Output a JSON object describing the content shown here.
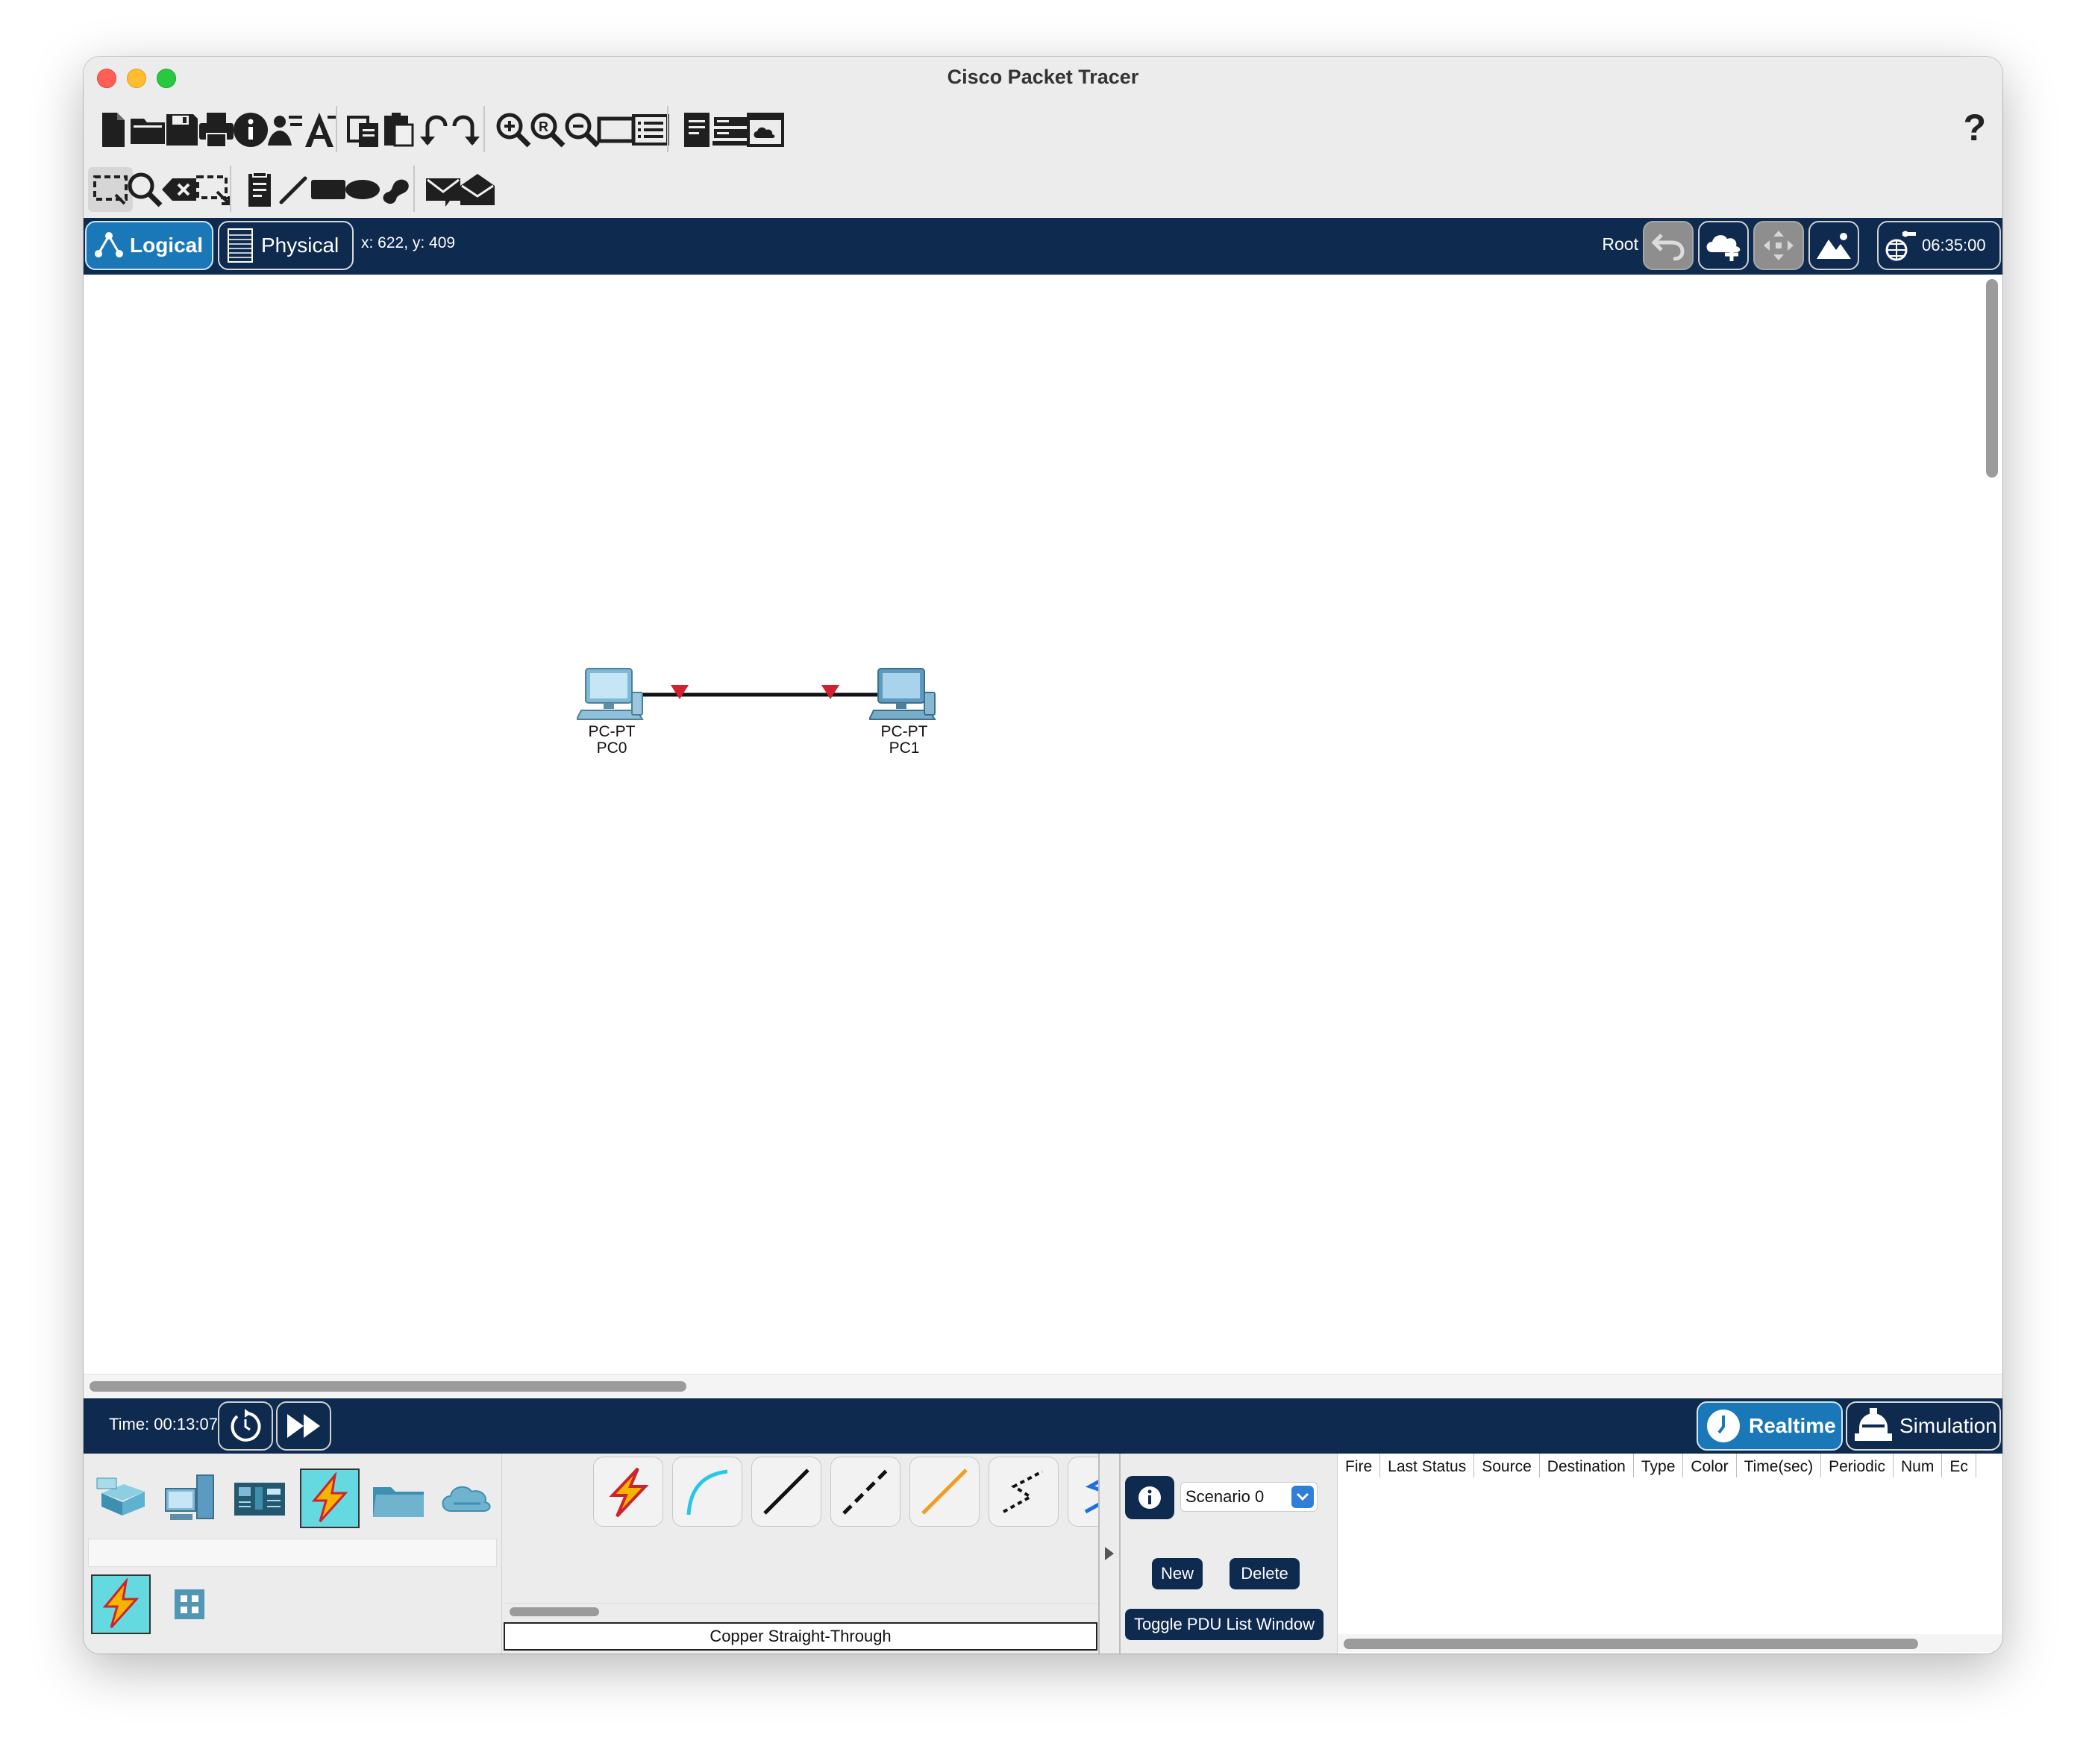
{
  "window": {
    "title": "Cisco Packet Tracer"
  },
  "toolbar": {
    "help_label": "?"
  },
  "nav": {
    "logical_label": "Logical",
    "physical_label": "Physical",
    "coords": "x: 622, y: 409",
    "root_label": "Root",
    "clock": "06:35:00"
  },
  "workspace": {
    "devices": [
      {
        "model": "PC-PT",
        "name": "PC0"
      },
      {
        "model": "PC-PT",
        "name": "PC1"
      }
    ]
  },
  "status": {
    "time": "Time: 00:13:07",
    "realtime_label": "Realtime",
    "simulation_label": "Simulation"
  },
  "cables": {
    "selected_name": "Copper Straight-Through"
  },
  "scenario": {
    "selected": "Scenario 0",
    "new_label": "New",
    "delete_label": "Delete",
    "toggle_label": "Toggle PDU List Window"
  },
  "pdu_list": {
    "columns": [
      "Fire",
      "Last Status",
      "Source",
      "Destination",
      "Type",
      "Color",
      "Time(sec)",
      "Periodic",
      "Num",
      "Ec"
    ]
  },
  "colors": {
    "navbar": "#0e2a4f",
    "accent": "#1b78b8",
    "link_marker": "#d0212f",
    "selected_category": "#65d9e0"
  }
}
